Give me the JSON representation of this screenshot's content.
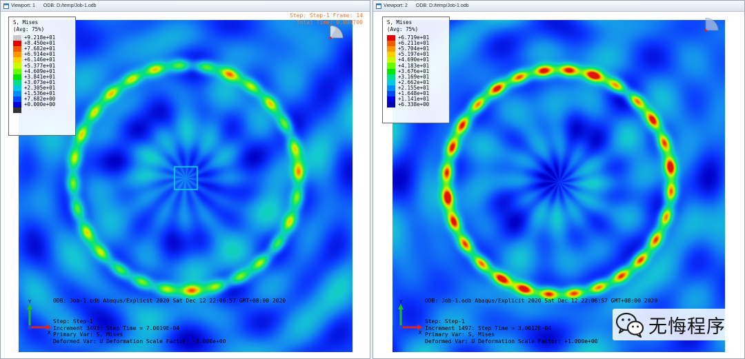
{
  "viewports": [
    {
      "title": "Viewport: 1",
      "odb_path": "ODB: D:/temp/Job-1.odb",
      "legend": {
        "title_line1": "S, Mises",
        "title_line2": "(Avg: 75%)",
        "rows": [
          {
            "color": "#c8c8c8",
            "value": "+9.218e+01"
          },
          {
            "color": "#e60000",
            "value": "+8.450e+01"
          },
          {
            "color": "#f25c00",
            "value": "+7.682e+01"
          },
          {
            "color": "#ff9600",
            "value": "+6.914e+01"
          },
          {
            "color": "#ffd000",
            "value": "+6.146e+01"
          },
          {
            "color": "#c8ff00",
            "value": "+5.377e+01"
          },
          {
            "color": "#64ff00",
            "value": "+4.609e+01"
          },
          {
            "color": "#00e600",
            "value": "+3.841e+01"
          },
          {
            "color": "#00e08c",
            "value": "+3.073e+01"
          },
          {
            "color": "#00c8e6",
            "value": "+2.305e+01"
          },
          {
            "color": "#008cff",
            "value": "+1.536e+01"
          },
          {
            "color": "#0046ff",
            "value": "+7.682e+00"
          },
          {
            "color": "#0000e0",
            "value": "+0.000e+00"
          },
          {
            "color": "#333333",
            "value": ""
          }
        ]
      },
      "step_info": {
        "line1": "Step: Step-1    Frame: 14",
        "line2": "Total Time: 0.000700"
      },
      "odb_line": "ODB: Job-1.odb    Abaqus/Explicit 2020    Sat Dec 12 22:06:57 GMT+08:00 2020",
      "step_line": "Step: Step-1",
      "increment_line": "Increment    3493: Step Time =   7.0019E-04",
      "primary_var_line": "Primary Var: S, Mises",
      "deformed_line": "Deformed Var: U   Deformation Scale Factor: +1.000e+00",
      "contour": {
        "ring_peak": 0.62,
        "center_square": true
      }
    },
    {
      "title": "Viewport: 2",
      "odb_path": "ODB: D:/temp/Job-1.odb",
      "legend": {
        "title_line1": "S, Mises",
        "title_line2": "(Avg: 75%)",
        "rows": [
          {
            "color": "#e60000",
            "value": "+6.719e+01"
          },
          {
            "color": "#f25c00",
            "value": "+6.211e+01"
          },
          {
            "color": "#ff9600",
            "value": "+5.704e+01"
          },
          {
            "color": "#ffd000",
            "value": "+5.197e+01"
          },
          {
            "color": "#c8ff00",
            "value": "+4.690e+01"
          },
          {
            "color": "#64ff00",
            "value": "+4.183e+01"
          },
          {
            "color": "#00e600",
            "value": "+3.676e+01"
          },
          {
            "color": "#00e08c",
            "value": "+3.169e+01"
          },
          {
            "color": "#00c8e6",
            "value": "+2.662e+01"
          },
          {
            "color": "#008cff",
            "value": "+2.155e+01"
          },
          {
            "color": "#0046ff",
            "value": "+1.648e+01"
          },
          {
            "color": "#0000e0",
            "value": "+1.141e+01"
          },
          {
            "color": "#0000b0",
            "value": "+6.338e+00"
          }
        ]
      },
      "step_info": {
        "line1": "",
        "line2": ""
      },
      "odb_line": "ODB: Job-1.odb    Abaqus/Explicit 2020    Sat Dec 12 22:06:57 GMT+08:00 2020",
      "step_line": "Step: Step-1",
      "increment_line": "Increment    1497: Step Time =   3.0012E-04",
      "primary_var_line": "Primary Var: S, Mises",
      "deformed_line": "Deformed Var: U   Deformation Scale Factor: +1.000e+00",
      "contour": {
        "ring_peak": 0.85,
        "center_square": false
      }
    }
  ],
  "watermark": {
    "text": "无悔程序",
    "logo_icon": "wechat-icon"
  },
  "colors": {
    "field_low": "#2040ff",
    "field_mid": "#18a8e8",
    "ring": "#32e070",
    "ring_hot": "#e01010"
  }
}
